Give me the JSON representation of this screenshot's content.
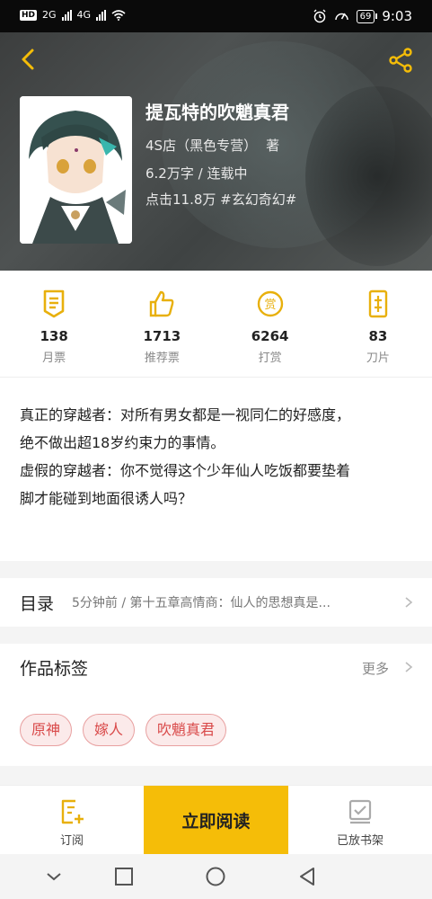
{
  "status_bar": {
    "network": "HD",
    "sim1": "2G",
    "sim2": "4G",
    "battery": "69",
    "time": "9:03"
  },
  "book": {
    "title": "提瓦特的吹魈真君",
    "author": "4S店（黑色专营）",
    "author_suffix": "著",
    "word_status": "6.2万字 / 连载中",
    "clicks_genre": "点击11.8万  #玄幻奇幻#"
  },
  "stats": [
    {
      "icon": "monthly-ticket-icon",
      "value": "138",
      "label": "月票"
    },
    {
      "icon": "thumbs-up-icon",
      "value": "1713",
      "label": "推荐票"
    },
    {
      "icon": "reward-coin-icon",
      "value": "6264",
      "label": "打赏"
    },
    {
      "icon": "blade-icon",
      "value": "83",
      "label": "刀片"
    }
  ],
  "description": {
    "line1": "真正的穿越者：对所有男女都是一视同仁的好感度，",
    "line2": "绝不做出超18岁约束力的事情。",
    "line3": "虚假的穿越者：你不觉得这个少年仙人吃饭都要垫着",
    "line4": "脚才能碰到地面很诱人吗？"
  },
  "toc": {
    "title": "目录",
    "latest": "5分钟前 / 第十五章高情商：仙人的思想真是..."
  },
  "tags": {
    "title": "作品标签",
    "more": "更多",
    "items": [
      "原神",
      "嫁人",
      "吹魈真君"
    ]
  },
  "actions": {
    "subscribe": "订阅",
    "read": "立即阅读",
    "shelf": "已放书架"
  },
  "colors": {
    "accent": "#f5bd08",
    "icon_gold": "#e8b00c",
    "tag_red": "#d94a4a"
  }
}
